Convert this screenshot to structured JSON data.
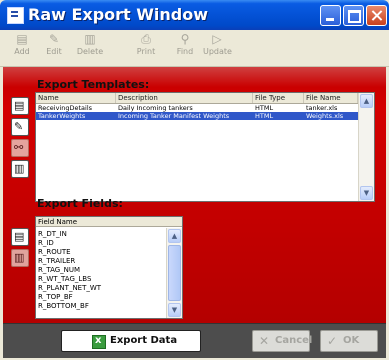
{
  "window": {
    "title": "Raw Export Window"
  },
  "toolbar": {
    "items": [
      {
        "label": "Add",
        "icon": "add-icon"
      },
      {
        "label": "Edit",
        "icon": "edit-icon"
      },
      {
        "label": "Delete",
        "icon": "delete-icon"
      },
      {
        "label": "Print",
        "icon": "print-icon"
      },
      {
        "label": "Find",
        "icon": "find-icon"
      },
      {
        "label": "Update",
        "icon": "update-icon"
      }
    ]
  },
  "templates": {
    "title": "Export Templates:",
    "columns": [
      "Name",
      "Description",
      "File Type",
      "File Name"
    ],
    "rows": [
      {
        "name": "ReceivingDetails",
        "description": "Daily Incoming tankers",
        "file_type": "HTML",
        "file_name": "tanker.xls",
        "selected": false
      },
      {
        "name": "TankerWeights",
        "description": "Incoming Tanker Manifest Weights",
        "file_type": "HTML",
        "file_name": "Weights.xls",
        "selected": true
      }
    ]
  },
  "fields": {
    "title": "Export Fields:",
    "column": "Field Name",
    "items": [
      "R_DT_IN",
      "R_ID",
      "R_ROUTE",
      "R_TRAILER",
      "R_TAG_NUM",
      "R_WT_TAG_LBS",
      "R_PLANT_NET_WT",
      "R_TOP_BF",
      "R_BOTTOM_BF"
    ]
  },
  "actions": {
    "export_label": "Export Data",
    "cancel_label": "Cancel",
    "ok_label": "OK"
  },
  "colors": {
    "panel_red": "#c00000",
    "titlebar_blue": "#0452d6",
    "selection_blue": "#2f57c9",
    "bottom_bar": "#4d4d4d"
  }
}
